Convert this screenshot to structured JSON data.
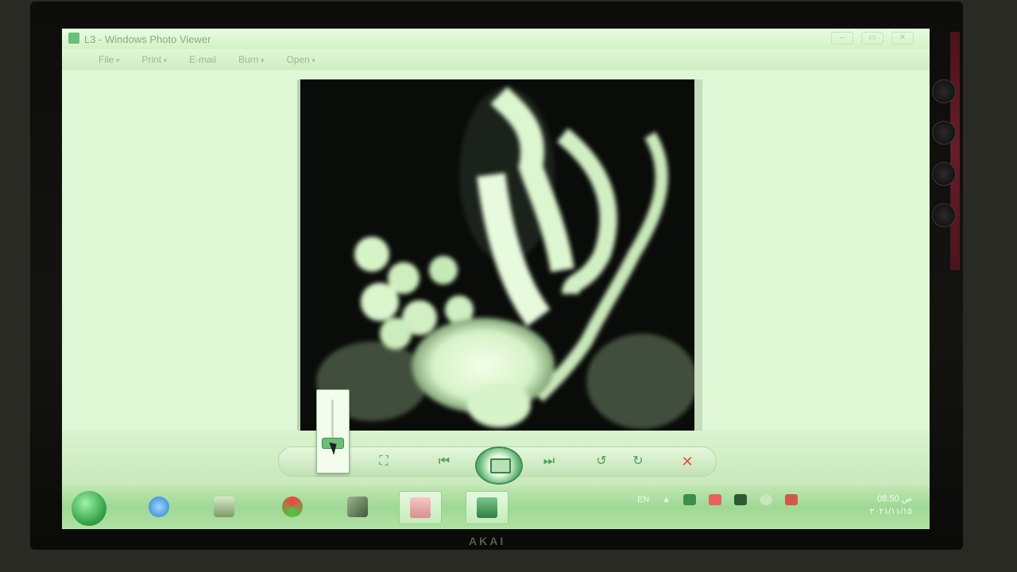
{
  "window": {
    "title": "L3 - Windows Photo Viewer"
  },
  "menu": [
    "File",
    "Print",
    "E-mail",
    "Burn",
    "Open"
  ],
  "window_controls": [
    "–",
    "▭",
    "✕"
  ],
  "help_label": "?",
  "controls": {
    "fit": "⛶",
    "previous": "⏮",
    "next": "⏭",
    "rotate_left": "↺",
    "rotate_right": "↻",
    "delete": "✕"
  },
  "zoom": {
    "level": 0.12
  },
  "taskbar": {
    "items": [
      "start-orb",
      "internet-explorer-icon",
      "network-folder-icon",
      "media-app-icon",
      "tools-icon",
      "photo-viewer-icon",
      "slideshow-icon"
    ]
  },
  "tray": {
    "language": "EN",
    "expand": "▲"
  },
  "clock": {
    "time": "08:50 ص",
    "date": "٢٠٢١/١١/١٥"
  },
  "tv": {
    "brand": "AKAI"
  }
}
